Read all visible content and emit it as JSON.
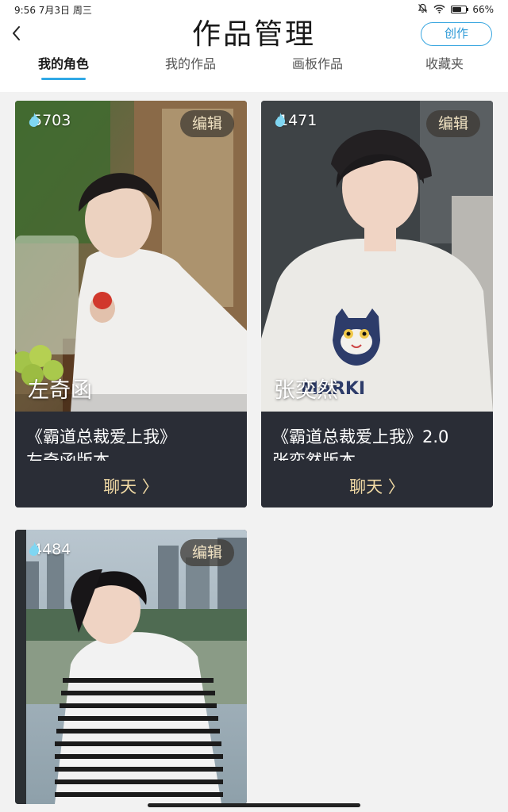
{
  "status_bar": {
    "time_date": "9:56 7月3日 周三",
    "battery": "66%",
    "battery_level": 0.66
  },
  "header": {
    "title": "作品管理",
    "create_label": "创作"
  },
  "tabs": [
    {
      "label": "我的角色",
      "active": true
    },
    {
      "label": "我的作品",
      "active": false
    },
    {
      "label": "画板作品",
      "active": false
    },
    {
      "label": "收藏夹",
      "active": false
    }
  ],
  "cards": [
    {
      "heat": "5703",
      "edit_label": "编辑",
      "name": "左奇函",
      "title": "《霸道总裁爱上我》",
      "subtitle": "左奇函版本",
      "chat_label": "聊天 〉"
    },
    {
      "heat": "1471",
      "edit_label": "编辑",
      "name": "张奕然",
      "title": "《霸道总裁爱上我》2.0",
      "subtitle": "张奕然版本",
      "chat_label": "聊天 〉"
    },
    {
      "heat": "4484",
      "edit_label": "编辑"
    }
  ],
  "colors": {
    "accent": "#30a8e6",
    "card_bg": "#2a2d36",
    "chat_text": "#f0d9a4",
    "heat_icon": "#7fd6f2"
  },
  "icons": {
    "back": "chevron-left-icon",
    "heat": "flame-icon",
    "status": [
      "mute-bell-icon",
      "wifi-icon",
      "battery-icon"
    ]
  }
}
